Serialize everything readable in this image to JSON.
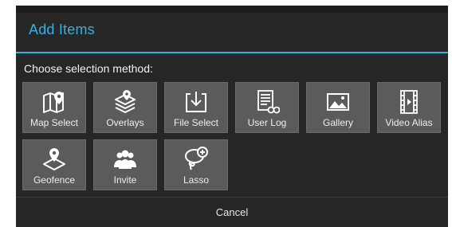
{
  "dialog": {
    "title": "Add Items",
    "subtitle": "Choose selection method:",
    "cancel_label": "Cancel",
    "accent_color": "#35b0df",
    "items": [
      {
        "label": "Map Select",
        "icon": "map-pin-icon"
      },
      {
        "label": "Overlays",
        "icon": "layers-icon"
      },
      {
        "label": "File Select",
        "icon": "file-import-icon"
      },
      {
        "label": "User Log",
        "icon": "log-binoculars-icon"
      },
      {
        "label": "Gallery",
        "icon": "image-icon"
      },
      {
        "label": "Video Alias",
        "icon": "film-icon"
      },
      {
        "label": "Geofence",
        "icon": "geofence-icon"
      },
      {
        "label": "Invite",
        "icon": "people-icon"
      },
      {
        "label": "Lasso",
        "icon": "lasso-icon"
      }
    ]
  }
}
